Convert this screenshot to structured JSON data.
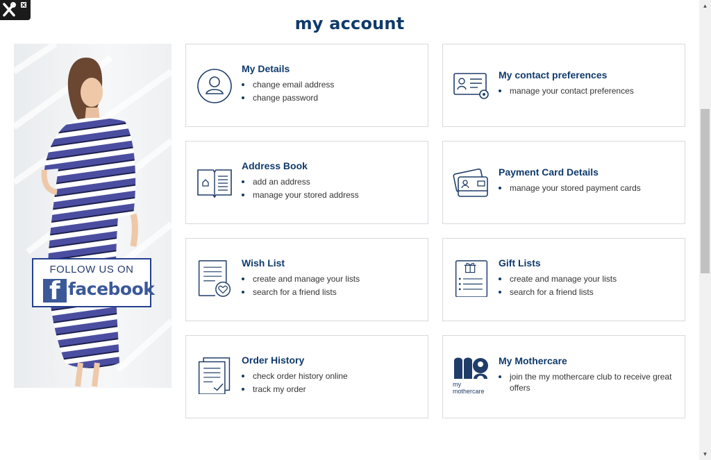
{
  "page": {
    "title": "my account"
  },
  "promo": {
    "follow_text": "FOLLOW US ON",
    "brand_word": "facebook",
    "brand_letter": "f",
    "dress_color": "#4b4ea0"
  },
  "colors": {
    "accent": "#0f3a6b",
    "border": "#d6d9dd",
    "facebook": "#3b5998"
  },
  "cards": [
    {
      "title": "My Details",
      "icon": "user-circle-icon",
      "items": [
        "change email address",
        "change password"
      ]
    },
    {
      "title": "My contact preferences",
      "icon": "contact-card-gear-icon",
      "items": [
        "manage your contact preferences"
      ]
    },
    {
      "title": "Address Book",
      "icon": "address-book-icon",
      "items": [
        "add an address",
        "manage your stored address"
      ]
    },
    {
      "title": "Payment Card Details",
      "icon": "payment-cards-icon",
      "items": [
        "manage your stored payment cards"
      ]
    },
    {
      "title": "Wish List",
      "icon": "wish-list-heart-icon",
      "items": [
        "create and manage your lists",
        "search for a friend lists"
      ]
    },
    {
      "title": "Gift Lists",
      "icon": "gift-list-icon",
      "items": [
        "create and manage your lists",
        "search for a friend lists"
      ]
    },
    {
      "title": "Order History",
      "icon": "order-history-icon",
      "items": [
        "check order history online",
        "track my order"
      ]
    },
    {
      "title": "My Mothercare",
      "icon": "mothercare-logo-icon",
      "logo_text": [
        "my",
        "mothercare"
      ],
      "items": [
        "join the my mothercare club to receive great offers"
      ]
    }
  ]
}
